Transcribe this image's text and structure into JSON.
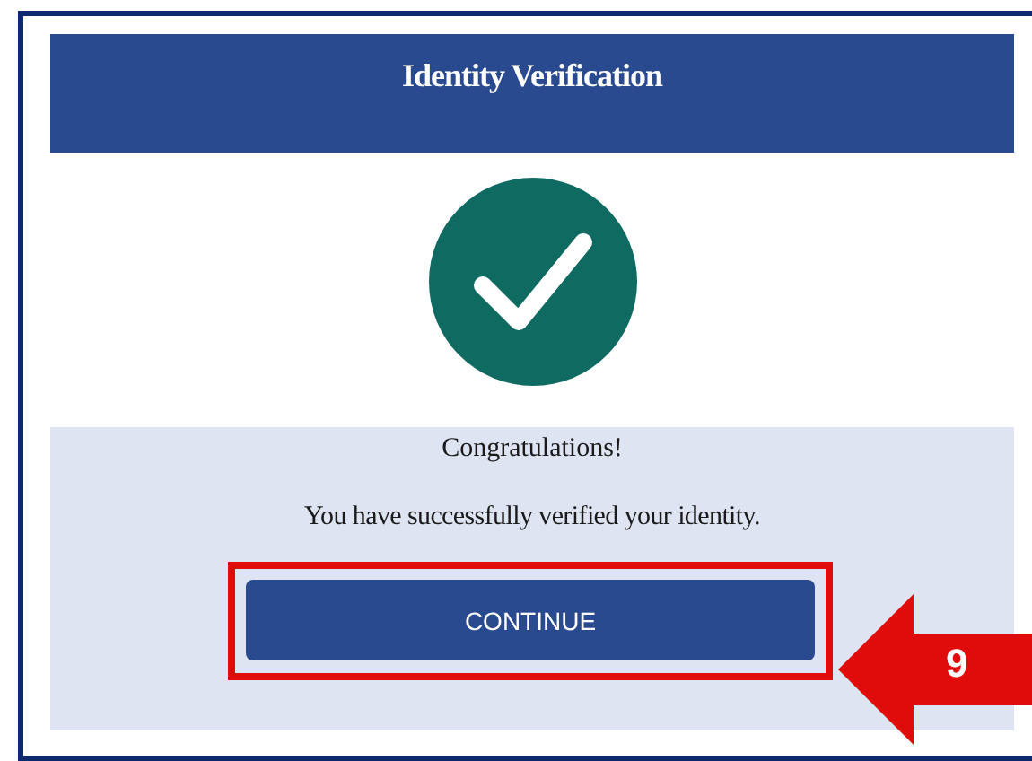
{
  "header": {
    "title": "Identity Verification"
  },
  "message": {
    "heading": "Congratulations!",
    "body": "You have successfully verified your identity."
  },
  "button": {
    "label": "CONTINUE"
  },
  "annotation": {
    "step": "9"
  }
}
